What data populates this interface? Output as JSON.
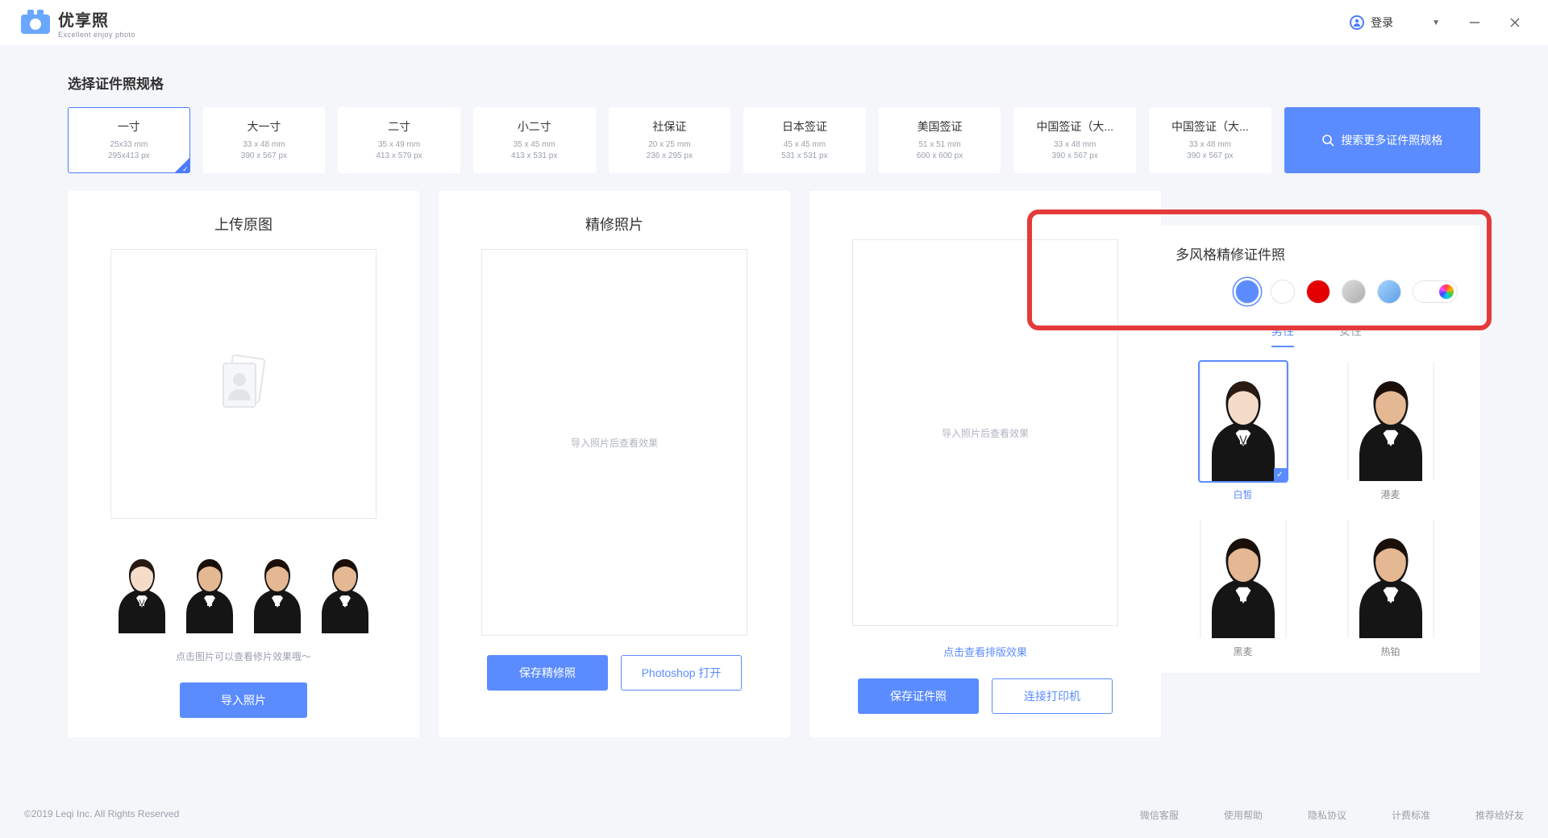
{
  "app": {
    "name": "优享照",
    "tagline": "Excellent enjoy photo"
  },
  "header": {
    "login": "登录"
  },
  "section_title": "选择证件照规格",
  "specs": [
    {
      "name": "一寸",
      "l1": "25x33 mm",
      "l2": "295x413 px",
      "selected": true
    },
    {
      "name": "大一寸",
      "l1": "33 x 48 mm",
      "l2": "390 x 567 px"
    },
    {
      "name": "二寸",
      "l1": "35 x 49 mm",
      "l2": "413 x 579 px"
    },
    {
      "name": "小二寸",
      "l1": "35 x 45 mm",
      "l2": "413 x 531 px"
    },
    {
      "name": "社保证",
      "l1": "20 x 25 mm",
      "l2": "236 x 295 px"
    },
    {
      "name": "日本签证",
      "l1": "45 x 45 mm",
      "l2": "531 x 531 px"
    },
    {
      "name": "美国签证",
      "l1": "51 x 51 mm",
      "l2": "600 x 600 px"
    },
    {
      "name": "中国签证（大...",
      "l1": "33 x 48 mm",
      "l2": "390 x 567 px"
    },
    {
      "name": "中国签证（大...",
      "l1": "33 x 48 mm",
      "l2": "390 x 567 px"
    }
  ],
  "search_more": "搜索更多证件照规格",
  "panel_left": {
    "title": "上传原图",
    "hint": "点击图片可以查看修片效果哦～",
    "import_btn": "导入照片"
  },
  "panel_mid": {
    "title": "精修照片",
    "placeholder": "导入照片后查看效果",
    "save_btn": "保存精修照",
    "ps_btn": "Photoshop 打开"
  },
  "panel_right": {
    "placeholder": "导入照片后查看效果",
    "link": "点击查看排版效果",
    "save_btn": "保存证件照",
    "print_btn": "连接打印机"
  },
  "style_panel": {
    "title": "多风格精修证件照",
    "colors": [
      {
        "hex": "#5b8cff",
        "selected": true
      },
      {
        "hex": "#ffffff"
      },
      {
        "hex": "#e40000"
      },
      {
        "hex": "#c8c8c8",
        "grad": "linear-gradient(135deg,#dcdcdc,#aeaeae)"
      },
      {
        "hex": "#6db7ff",
        "grad": "linear-gradient(135deg,#a8d4ff,#5aa0e8)"
      }
    ],
    "gender_tabs": {
      "male": "男性",
      "female": "女性"
    },
    "styles": [
      {
        "label": "白皙",
        "selected": true
      },
      {
        "label": "港麦"
      },
      {
        "label": "黑麦"
      },
      {
        "label": "热铂"
      }
    ]
  },
  "footer": {
    "copy": "©2019 Leqi Inc. All Rights Reserved",
    "links": [
      "微信客服",
      "使用帮助",
      "隐私协议",
      "计费标准",
      "推荐给好友"
    ]
  }
}
